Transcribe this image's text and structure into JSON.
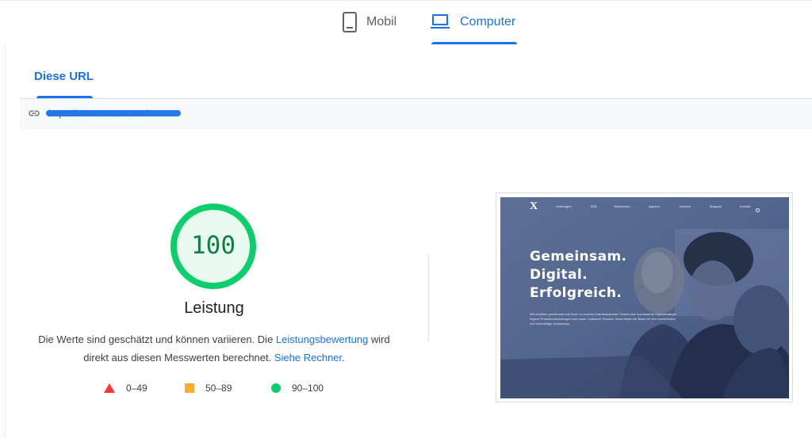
{
  "device_tabs": [
    {
      "label": "Mobil",
      "active": false,
      "icon": "phone-icon"
    },
    {
      "label": "Computer",
      "active": true,
      "icon": "laptop-icon"
    }
  ],
  "section_tab": {
    "label": "Diese URL"
  },
  "url": {
    "text": "https://www.xxxxxx.xxx/",
    "redacted": true
  },
  "score": {
    "value": "100",
    "fraction": 1.0,
    "label": "Leistung",
    "color": "#0cce6b"
  },
  "description": {
    "part1": "Die Werte sind geschätzt und können variieren. Die ",
    "link1": "Leistungsbewertung",
    "part2": " wird direkt aus diesen Messwerten berechnet. ",
    "link2": "Siehe Rechner",
    "part3": "."
  },
  "legend": [
    {
      "range": "0–49",
      "shape": "triangle",
      "color": "#ff3333"
    },
    {
      "range": "50–89",
      "shape": "square",
      "color": "#ffaa33"
    },
    {
      "range": "90–100",
      "shape": "circle",
      "color": "#0cce6b"
    }
  ],
  "preview": {
    "logo": "X",
    "logo_sub": "",
    "nav": [
      "Leistungen",
      "B2B",
      "Referenzen",
      "Agentur",
      "Karriere",
      "Magazin",
      "Kontakt"
    ],
    "headline": [
      "Gemeinsam.",
      "Digital.",
      "Erfolgreich."
    ],
    "body": "Wir erstellen gemeinsam mit Ihnen in unseren interdisziplinären Teams eine durchdachte Digitalstrategie. Eigene Produktentwicklungen und unser Customer Success Team bilden die Basis für eine kundennahe und nachhaltige Umsetzung."
  }
}
